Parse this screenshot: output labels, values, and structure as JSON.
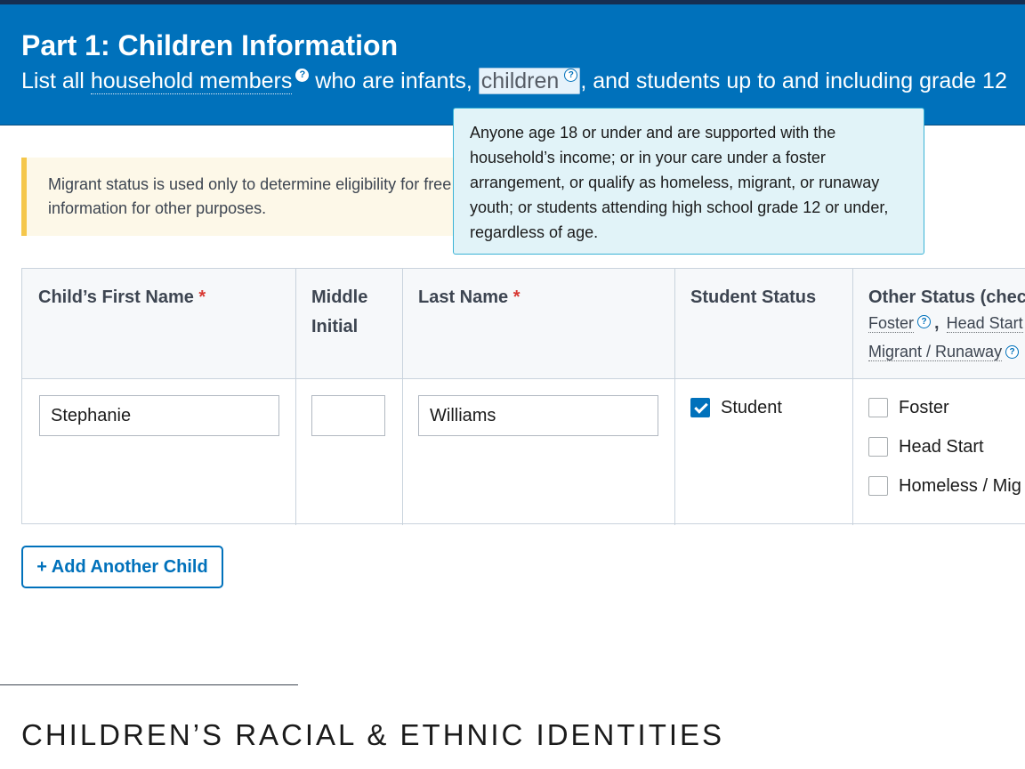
{
  "header": {
    "title": "Part 1: Children Information",
    "subtitle_prefix": "List all",
    "term_household": "household members",
    "subtitle_middle": "who are infants,",
    "term_children": "children",
    "subtitle_suffix": ", and students up to and including grade 12",
    "help_glyph": "?"
  },
  "tooltip": {
    "text": "Anyone age 18 or under and are supported with the household’s income; or in your care under a foster arrangement, or qualify as homeless, migrant, or runaway youth; or students attending high school grade 12 or under, regardless of age."
  },
  "alert": {
    "line1": "Migrant status is used only to determine eligibility for free",
    "line2": "information for other purposes."
  },
  "table": {
    "headers": {
      "first_name": "Child’s First Name",
      "middle_initial_1": "Middle",
      "middle_initial_2": "Initial",
      "last_name": "Last Name",
      "student_status": "Student Status",
      "other_status": "Other Status (chec"
    },
    "required_mark": "*",
    "other_status_terms": {
      "foster": "Foster",
      "comma": ",",
      "head_start": "Head Start",
      "migrant_runaway": "Migrant / Runaway"
    },
    "row": {
      "first_name": "Stephanie",
      "middle_initial": "",
      "last_name": "Williams",
      "student_label": "Student",
      "student_checked": true,
      "foster_label": "Foster",
      "head_start_label": "Head Start",
      "homeless_label": "Homeless / Mig"
    }
  },
  "buttons": {
    "add_child": "+ Add Another Child"
  },
  "section": {
    "title": "CHILDREN’S RACIAL & ETHNIC IDENTITIES"
  },
  "colors": {
    "header_bg": "#0071bb",
    "accent": "#0071bb",
    "required": "#d83933",
    "alert_border": "#f5c74b",
    "tooltip_bg": "#e1f3f8"
  }
}
